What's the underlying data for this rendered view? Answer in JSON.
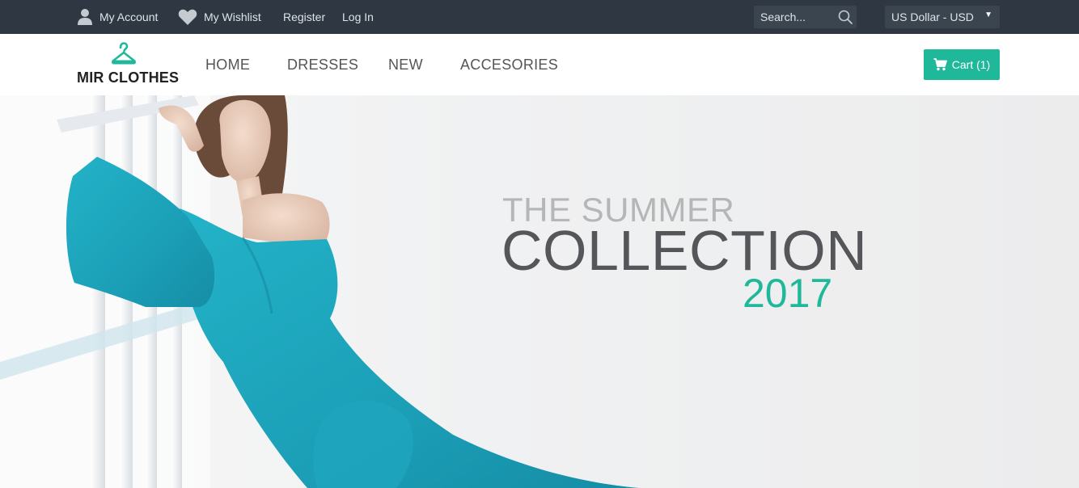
{
  "topbar": {
    "account_label": "My Account",
    "wishlist_label": "My Wishlist",
    "register_label": "Register",
    "login_label": "Log In",
    "search": {
      "placeholder": "Search..."
    },
    "currency": {
      "selected": "US Dollar - USD"
    }
  },
  "brand": {
    "name": "MIR CLOTHES",
    "icon": "hanger-icon",
    "accent_color": "#1fb89a"
  },
  "nav": {
    "home": "HOME",
    "dresses": "DRESSES",
    "new": "NEW",
    "accessories": "ACCESORIES"
  },
  "cart": {
    "label": "Cart (1)",
    "icon": "cart-icon"
  },
  "hero": {
    "line1": "THE SUMMER",
    "line2": "COLLECTION",
    "line3": "2017",
    "image_icon": "model-photo"
  },
  "colors": {
    "topbar_bg": "#2f3842",
    "accent": "#1fb89a",
    "dress": "#1aa6bd"
  }
}
